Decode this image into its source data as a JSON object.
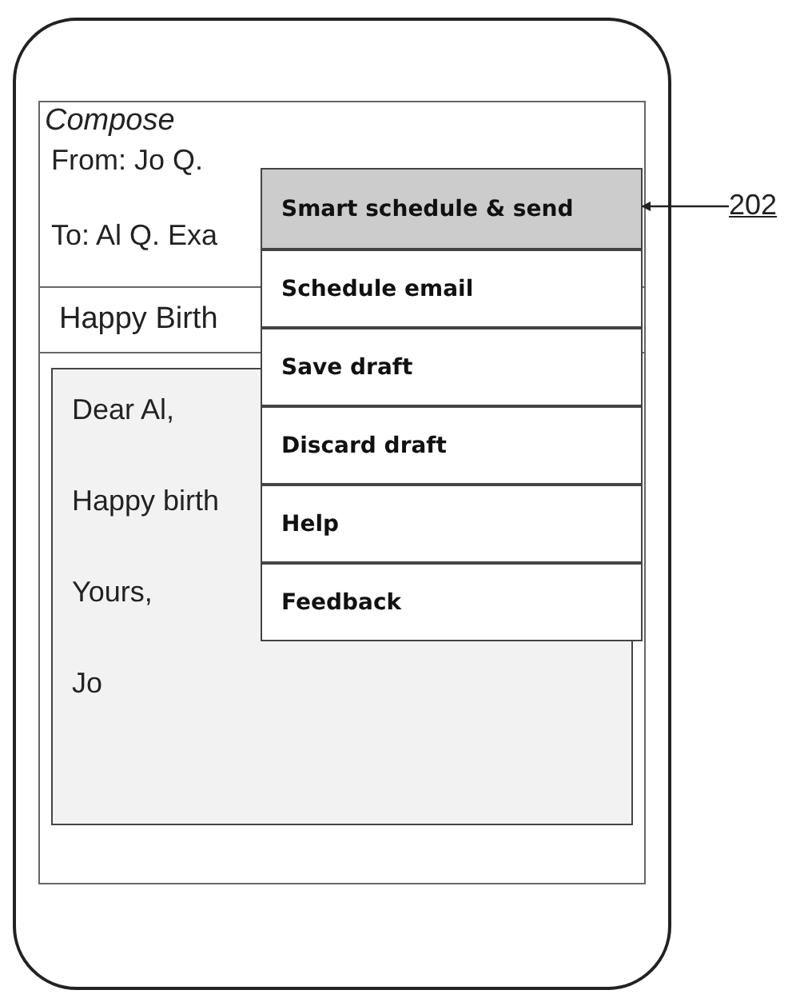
{
  "screen": {
    "title": "Compose",
    "from": "From: Jo Q.",
    "to": "To: Al Q. Exa",
    "subject": "Happy Birth",
    "body": [
      "Dear Al,",
      "Happy birth",
      "Yours,",
      "Jo"
    ]
  },
  "menu": {
    "items": [
      {
        "label": "Smart schedule & send",
        "selected": true
      },
      {
        "label": "Schedule email",
        "selected": false
      },
      {
        "label": "Save draft",
        "selected": false
      },
      {
        "label": "Discard draft",
        "selected": false
      },
      {
        "label": "Help",
        "selected": false
      },
      {
        "label": "Feedback",
        "selected": false
      }
    ]
  },
  "callout": {
    "label": "202"
  }
}
